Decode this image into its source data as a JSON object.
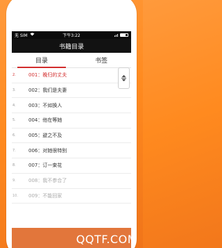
{
  "statusbar": {
    "carrier": "无 SIM",
    "time": "下午3:22"
  },
  "header": {
    "title": "书籍目录"
  },
  "tabs": [
    {
      "label": "目录"
    },
    {
      "label": "书签"
    }
  ],
  "chapters": [
    {
      "index": "2.",
      "title": "001：晚归的丈夫",
      "current": true
    },
    {
      "index": "3.",
      "title": "002：我们是夫妻",
      "current": false
    },
    {
      "index": "4.",
      "title": "003：不如换人",
      "current": false
    },
    {
      "index": "5.",
      "title": "004：他在等她",
      "current": false
    },
    {
      "index": "6.",
      "title": "005：避之不及",
      "current": false
    },
    {
      "index": "7.",
      "title": "006：对她很特别",
      "current": false
    },
    {
      "index": "8.",
      "title": "007：订一束花",
      "current": false
    },
    {
      "index": "9.",
      "title": "008：我不参合了",
      "current": false
    },
    {
      "index": "10.",
      "title": "009：不能回家",
      "current": false
    }
  ],
  "watermark": "QQTF.COM",
  "colors": {
    "accent": "#d22c2c",
    "background": "#ff8a1f",
    "header": "#121212"
  },
  "icons": {
    "scroll_handle": "up-down-arrows-icon"
  }
}
